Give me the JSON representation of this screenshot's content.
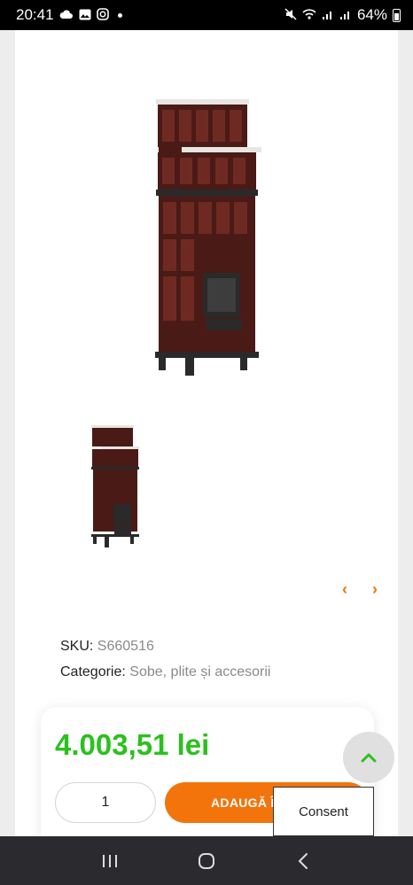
{
  "status_bar": {
    "time": "20:41",
    "battery": "64%",
    "left_icons": [
      "cloud-sync-icon",
      "gallery-icon",
      "instagram-icon"
    ],
    "right_icons": [
      "mute-icon",
      "wifi-call-icon",
      "signal-1-icon",
      "signal-2-icon",
      "battery-icon"
    ]
  },
  "product": {
    "sku_label": "SKU:",
    "sku_value": "S660516",
    "category_label": "Categorie:",
    "category_value": "Sobe, plite și accesorii",
    "price": "4.003,51 lei",
    "quantity": "1",
    "add_button_label": "ADAUGĂ  Î",
    "stove_colors": {
      "body": "#4a1a16",
      "top": "#e8e6e0",
      "metal": "#2a2a2a"
    }
  },
  "gallery": {
    "prev_icon": "chevron-left-icon",
    "next_icon": "chevron-right-icon",
    "prev_label": "‹",
    "next_label": "›"
  },
  "overlay": {
    "consent_label": "Consent",
    "scroll_top_icon": "chevron-up-icon"
  },
  "colors": {
    "accent": "#f2740b",
    "price": "#2cc01f"
  },
  "nav_bar": {
    "icons": [
      "recent-apps-icon",
      "home-icon",
      "back-icon"
    ]
  }
}
